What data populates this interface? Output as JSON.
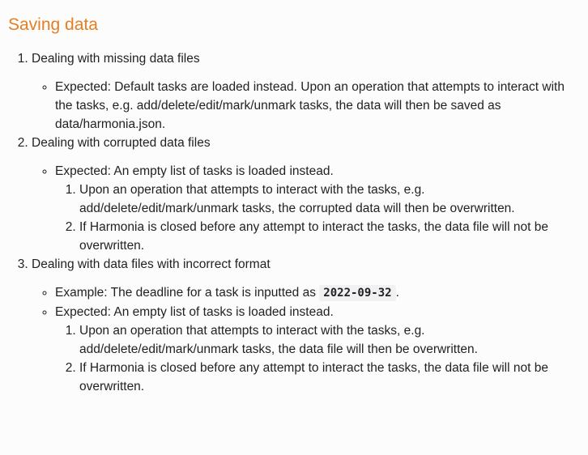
{
  "heading": "Saving data",
  "items": [
    {
      "title": "Dealing with missing data files",
      "points": [
        {
          "text": "Expected: Default tasks are loaded instead. Upon an operation that attempts to interact with the tasks, e.g. add/delete/edit/mark/unmark tasks, the data will then be saved as data/harmonia.json."
        }
      ]
    },
    {
      "title": "Dealing with corrupted data files",
      "points": [
        {
          "text": "Expected: An empty list of tasks is loaded instead.",
          "sub": [
            "Upon an operation that attempts to interact with the tasks, e.g. add/delete/edit/mark/unmark tasks, the corrupted data will then be overwritten.",
            "If Harmonia is closed before any attempt to interact the tasks, the data file will not be overwritten."
          ]
        }
      ]
    },
    {
      "title": "Dealing with data files with incorrect format",
      "example_prefix": "Example: The deadline for a task is inputted as",
      "example_code": "2022-09-32",
      "example_suffix": ".",
      "points": [
        {
          "text": "Expected: An empty list of tasks is loaded instead.",
          "sub": [
            "Upon an operation that attempts to interact with the tasks, e.g. add/delete/edit/mark/unmark tasks, the data file will then be overwritten.",
            "If Harmonia is closed before any attempt to interact the tasks, the data file will not be overwritten."
          ]
        }
      ]
    }
  ],
  "colors": {
    "heading": "#e67e22",
    "text": "#222222",
    "code_bg": "#f1f1f4"
  }
}
